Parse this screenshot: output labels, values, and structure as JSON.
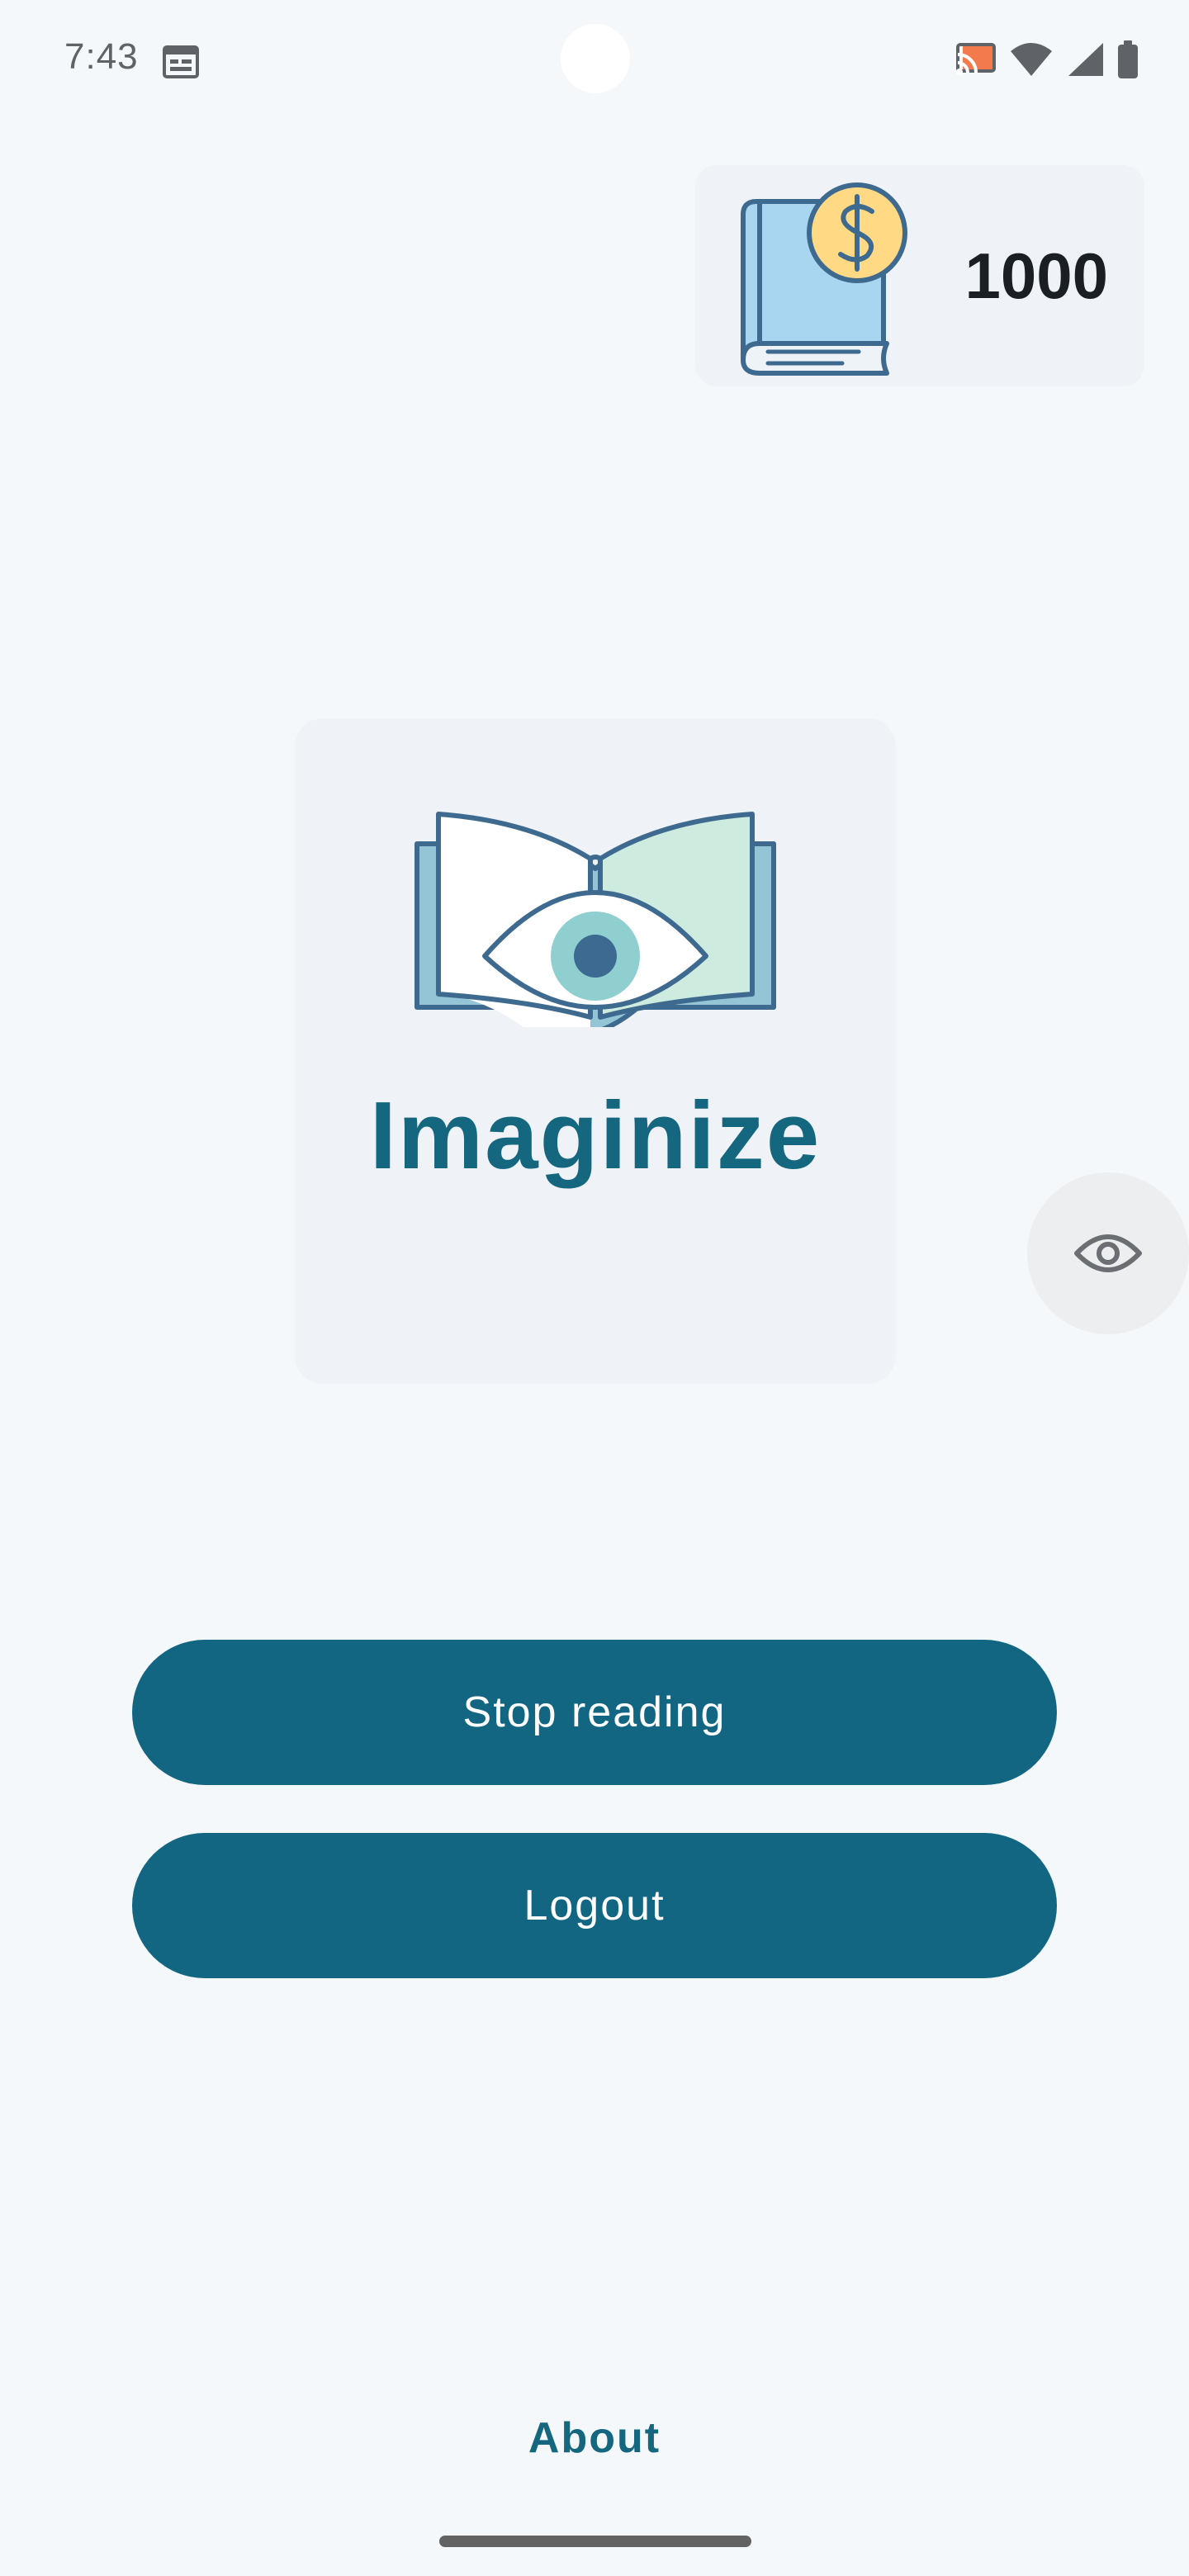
{
  "status_bar": {
    "time": "7:43",
    "icons": [
      "calendar-icon",
      "cast-icon",
      "wifi-icon",
      "signal-icon",
      "battery-icon"
    ]
  },
  "wallet": {
    "amount": "1000",
    "icon": "book-coin-icon",
    "colors": {
      "book": "#a8d6f0",
      "coin": "#ffd983",
      "outline": "#3f6a8f"
    }
  },
  "logo": {
    "title": "Imaginize",
    "icon": "open-book-eye-icon",
    "colors": {
      "title": "#14677f",
      "left_page": "#ffffff",
      "right_page": "#cdebdf",
      "cover": "#94c5d6",
      "iris": "#8fcfd0",
      "pupil": "#3d6a91"
    }
  },
  "eye_toggle": {
    "icon": "eye-icon"
  },
  "buttons": {
    "stop_reading": "Stop reading",
    "logout": "Logout"
  },
  "footer": {
    "about": "About"
  },
  "theme": {
    "background": "#f5f8fb",
    "button": "#126682",
    "card": "#eff2f6"
  }
}
